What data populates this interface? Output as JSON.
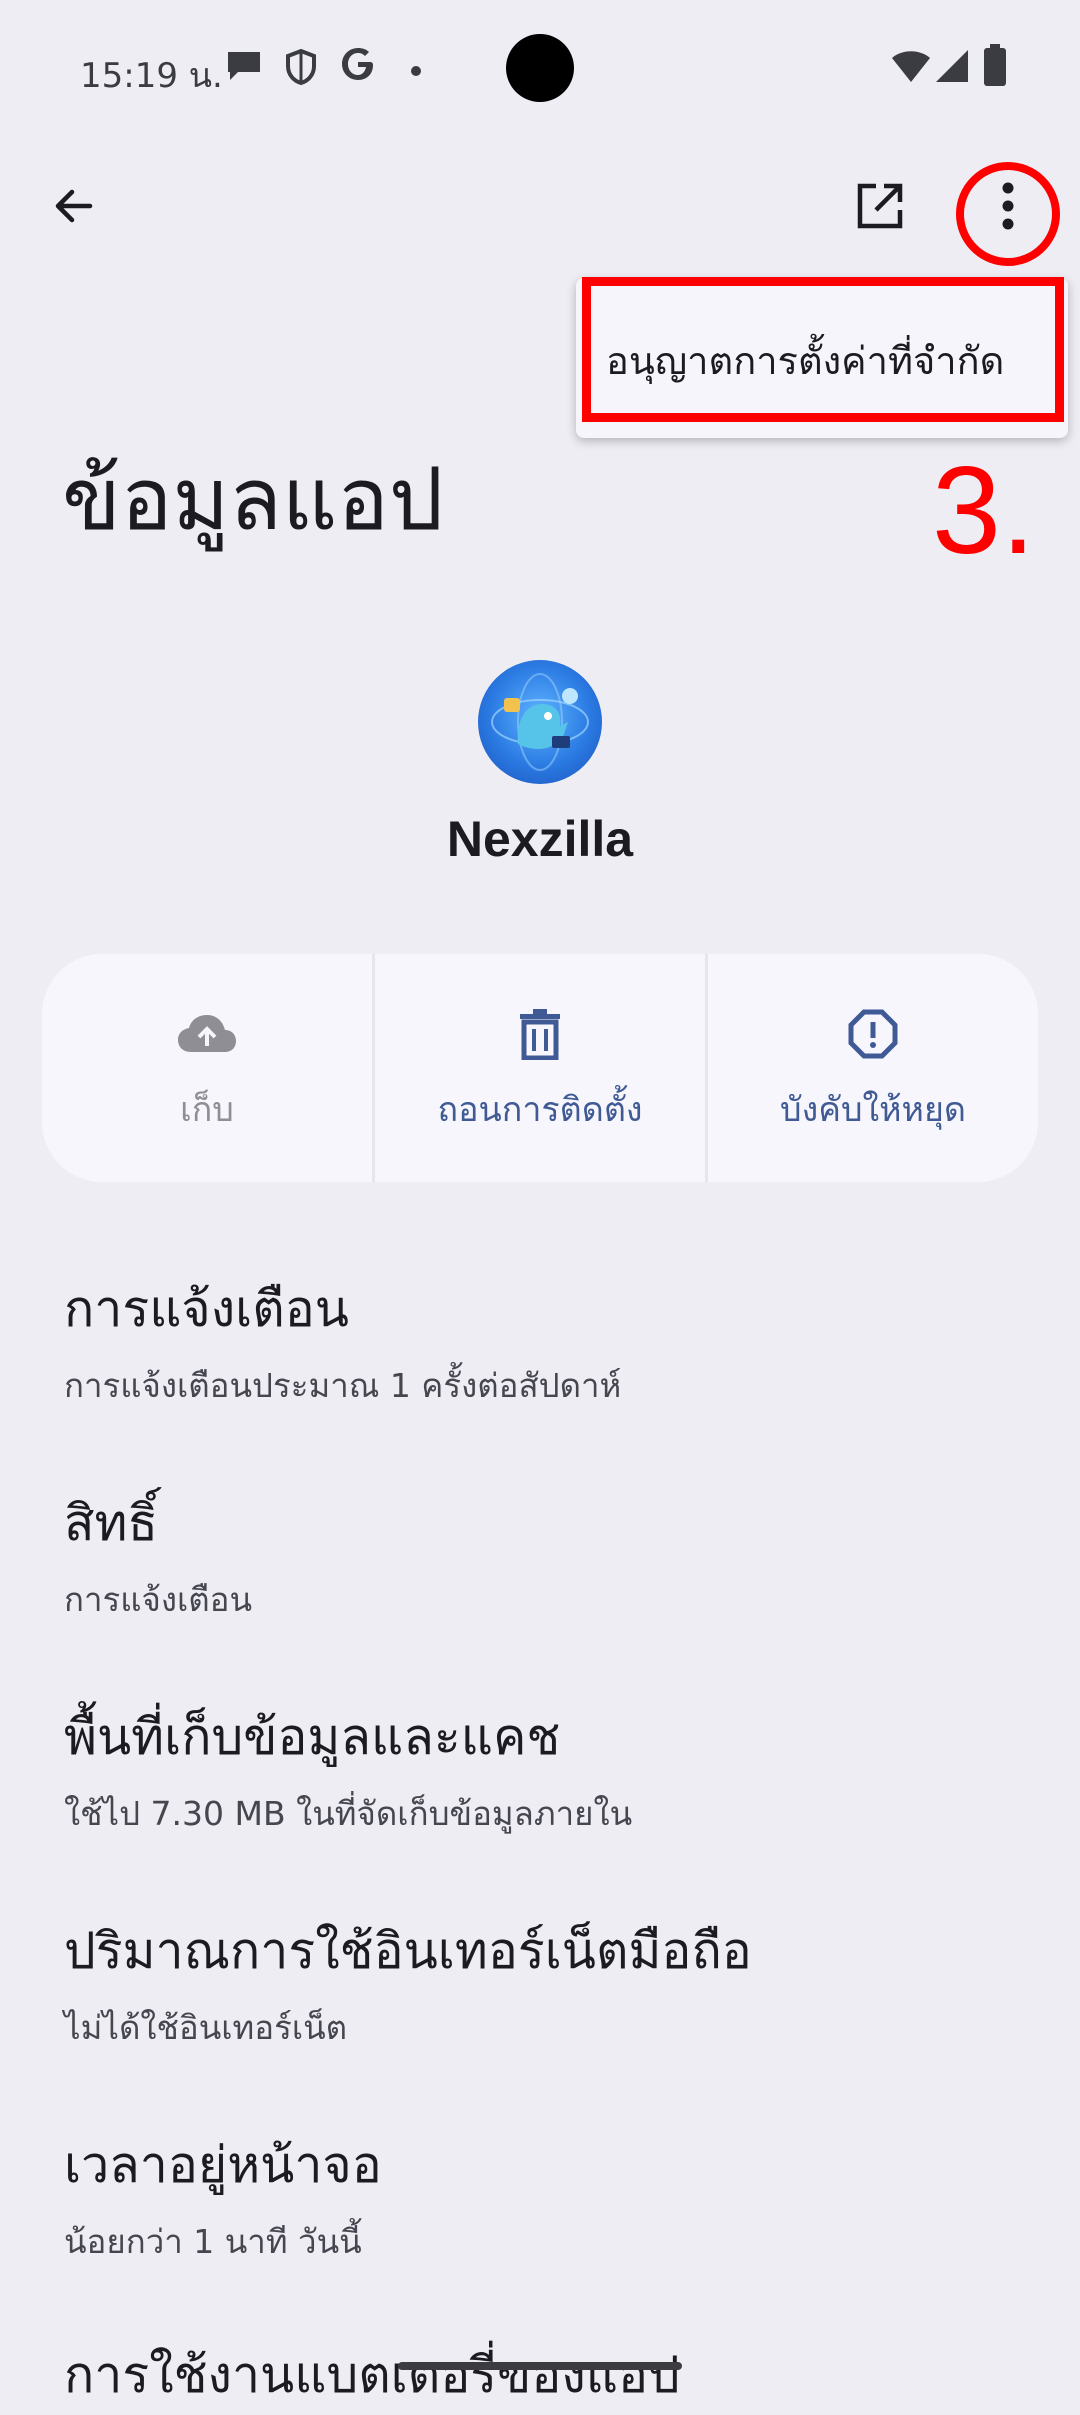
{
  "status_bar": {
    "time": "15:19 น.",
    "icons": [
      "chat-bubble-icon",
      "shield-icon",
      "google-icon",
      "dot-icon",
      "wifi-icon",
      "signal-icon",
      "battery-icon"
    ]
  },
  "top_bar": {
    "back_icon": "arrow-left-icon",
    "open_icon": "open-in-new-icon",
    "more_icon": "more-vert-icon"
  },
  "menu": {
    "item_label": "อนุญาตการตั้งค่าที่จำกัด"
  },
  "annotation": {
    "step": "3.",
    "color": "#ff0000"
  },
  "page": {
    "title": "ข้อมูลแอป"
  },
  "app": {
    "name": "Nexzilla"
  },
  "actions": [
    {
      "label": "เก็บ",
      "icon": "cloud-upload-icon",
      "enabled": false
    },
    {
      "label": "ถอนการติดตั้ง",
      "icon": "trash-icon",
      "enabled": true
    },
    {
      "label": "บังคับให้หยุด",
      "icon": "alert-octagon-icon",
      "enabled": true
    }
  ],
  "settings": [
    {
      "title": "การแจ้งเตือน",
      "subtitle": "การแจ้งเตือนประมาณ 1 ครั้งต่อสัปดาห์"
    },
    {
      "title": "สิทธิ์",
      "subtitle": "การแจ้งเตือน"
    },
    {
      "title": "พื้นที่เก็บข้อมูลและแคช",
      "subtitle": "ใช้ไป 7.30 MB ในที่จัดเก็บข้อมูลภายใน"
    },
    {
      "title": "ปริมาณการใช้อินเทอร์เน็ตมือถือ",
      "subtitle": "ไม่ได้ใช้อินเทอร์เน็ต"
    },
    {
      "title": "เวลาอยู่หน้าจอ",
      "subtitle": "น้อยกว่า 1 นาที วันนี้"
    },
    {
      "title": "การใช้งานแบตเตอรี่ของแอป"
    }
  ],
  "colors": {
    "background": "#eeedf4",
    "card": "#f7f6fc",
    "accent": "#3f5a94",
    "disabled": "#8e8e94"
  }
}
